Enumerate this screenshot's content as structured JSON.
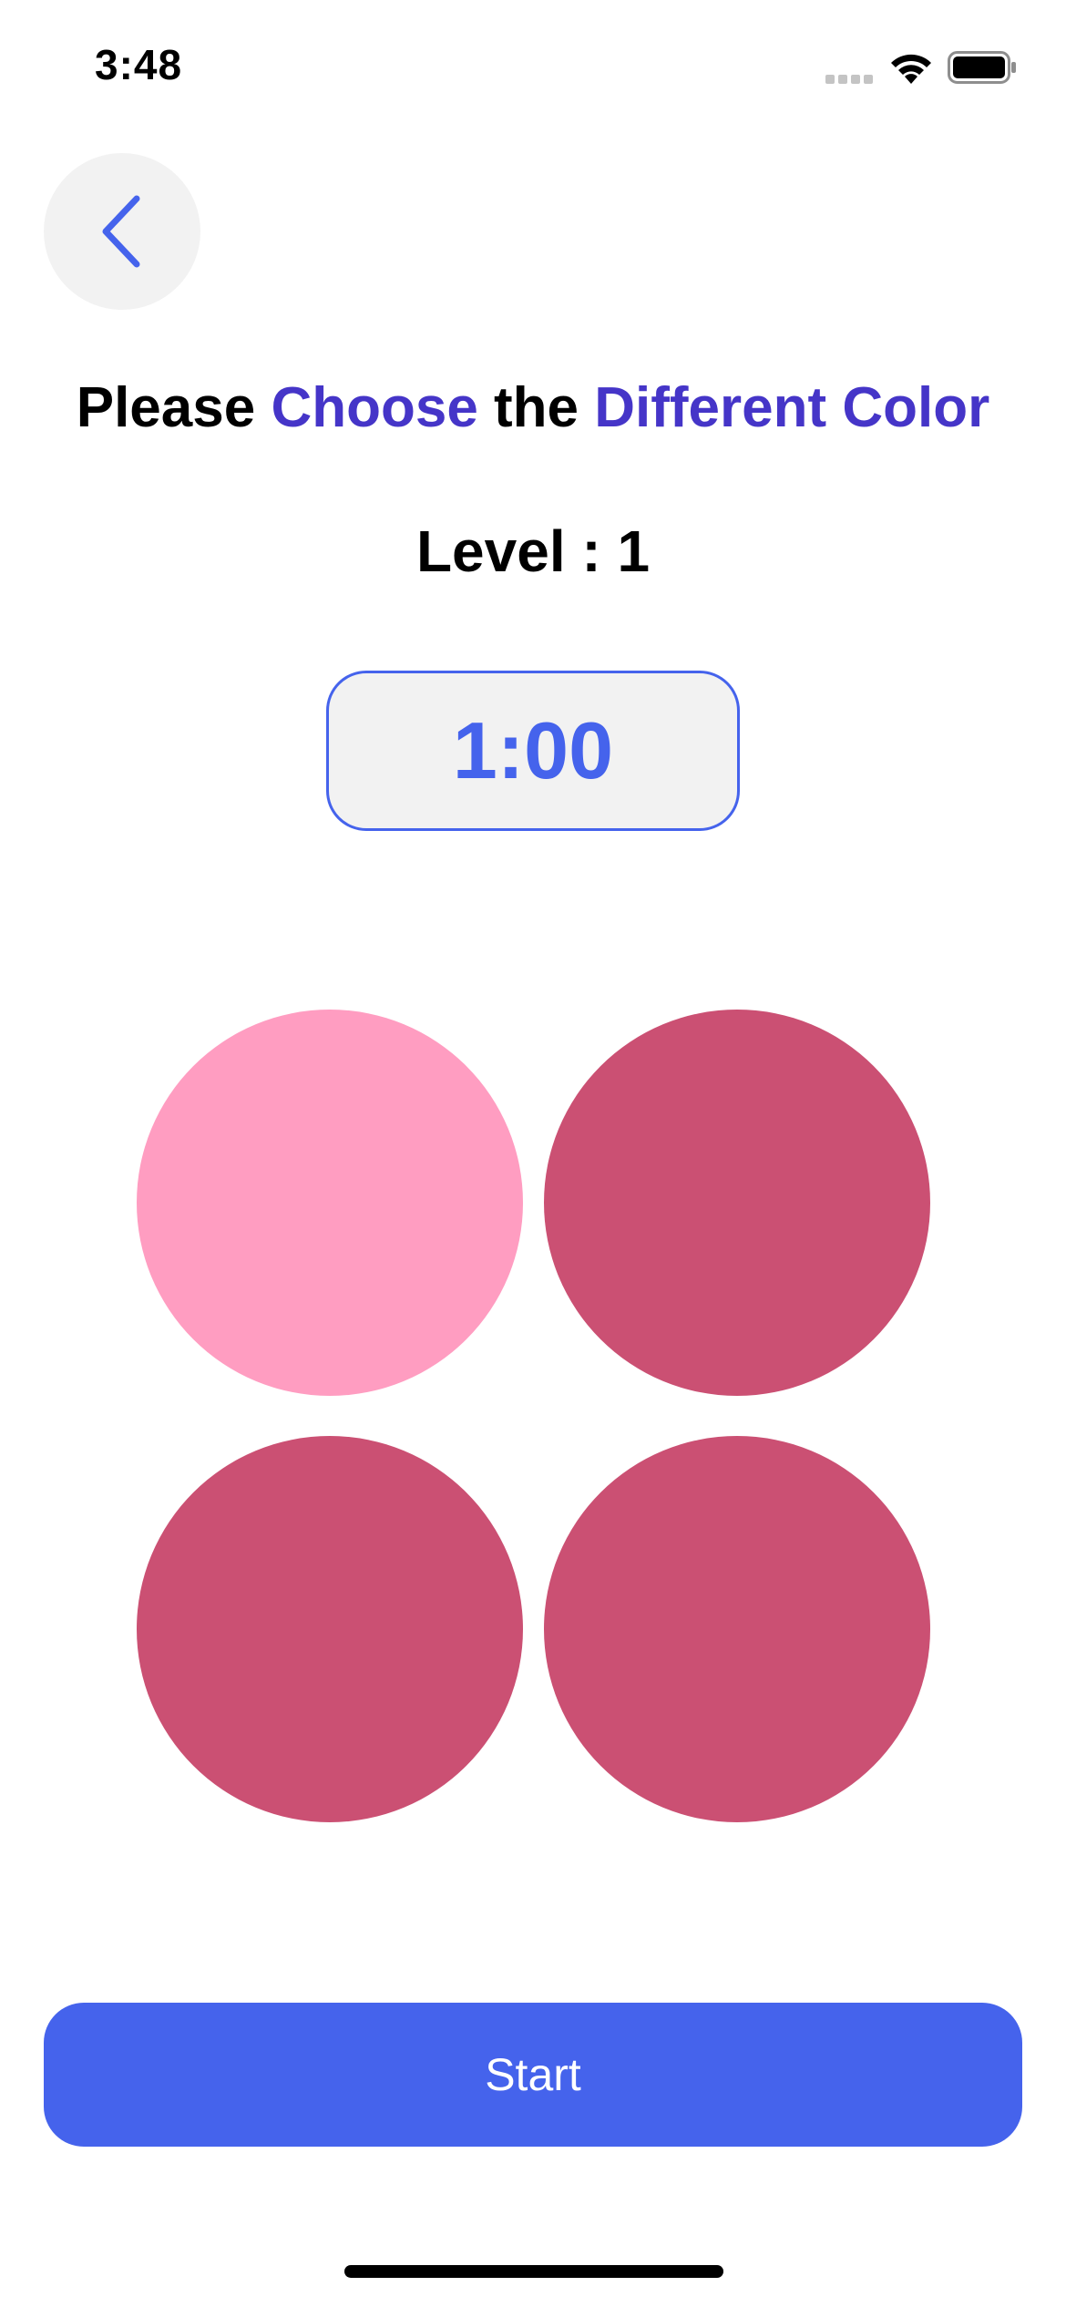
{
  "status_bar": {
    "time": "3:48"
  },
  "header": {
    "back_icon": "chevron-left-icon"
  },
  "title": {
    "part1": "Please ",
    "part2": "Choose",
    "part3": " the ",
    "part4": "Different Color"
  },
  "level": {
    "text": "Level : 1"
  },
  "timer": {
    "value": "1:00"
  },
  "circles": [
    {
      "color": "#ff9dc1"
    },
    {
      "color": "#cb5073"
    },
    {
      "color": "#cb5073"
    },
    {
      "color": "#cb5073"
    }
  ],
  "start_button": {
    "label": "Start"
  },
  "colors": {
    "primary": "#4563ec",
    "accent": "#4535c8"
  }
}
